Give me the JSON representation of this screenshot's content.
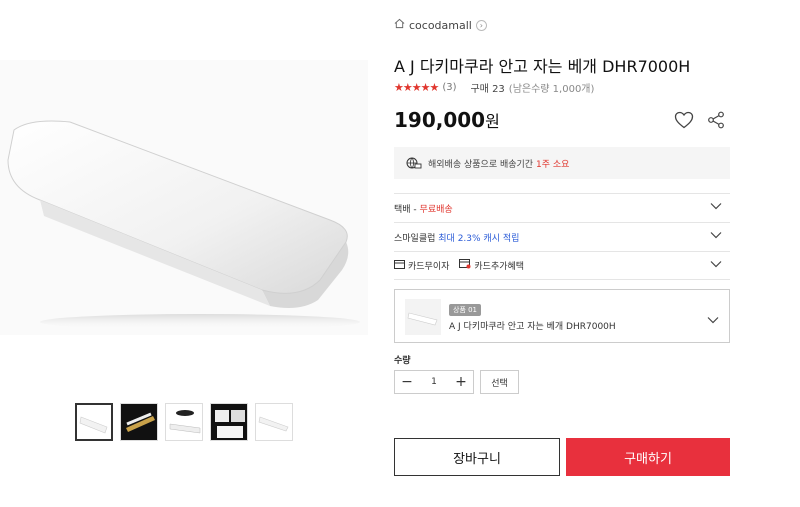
{
  "store": {
    "name": "cocodamall",
    "icon": "home-icon",
    "chevron_icon": "chevron-right-icon"
  },
  "product": {
    "title": "A J 다키마쿠라 안고 자는 베개 DHR7000H",
    "stars": "★★★★★",
    "rating_count": "(3)",
    "purchase_count": "구매 23",
    "stock": "(남은수량 1,000개)",
    "price": "190,000",
    "price_unit": "원"
  },
  "actions": {
    "heart_icon": "heart-icon",
    "share_icon": "share-icon"
  },
  "shipping": {
    "text_prefix": "해외배송 상품으로 배송기간",
    "duration": "1주 소요",
    "icon": "global-shipping-icon"
  },
  "options": {
    "delivery_label": "택배 - ",
    "delivery_value": "무료배송",
    "smile_label": "스마일클럽 ",
    "smile_value": "최대 2.3% 캐시 적립",
    "card_interest": "카드무이자",
    "card_benefit": "카드추가혜택"
  },
  "selected_option": {
    "badge": "상품 01",
    "name": "A J 다키마쿠라 안고 자는 베개 DHR7000H"
  },
  "quantity": {
    "label": "수량",
    "minus": "−",
    "value": "1",
    "plus": "+",
    "select_label": "선택"
  },
  "buttons": {
    "cart": "장바구니",
    "buy": "구매하기"
  },
  "colors": {
    "accent": "#e0362e",
    "buy_button": "#e8303d"
  },
  "thumbnails": [
    "pillow-thumb-1",
    "pillow-thumb-2",
    "pillow-thumb-3",
    "pillow-thumb-4",
    "pillow-thumb-5"
  ]
}
